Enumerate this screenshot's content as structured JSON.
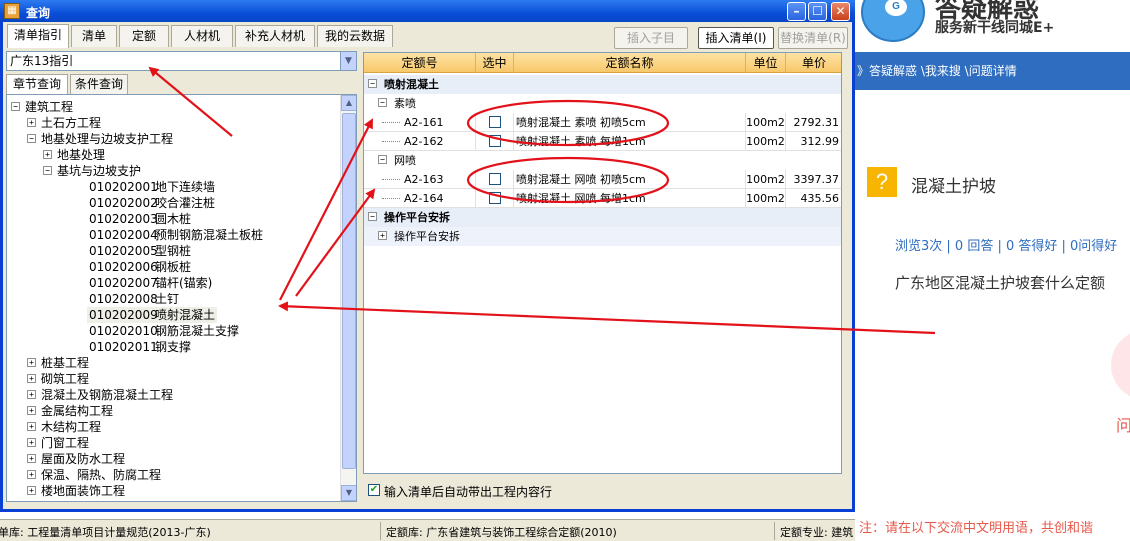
{
  "window": {
    "title": "查询",
    "icon": "calculator-icon",
    "min_glyph": "–",
    "max_glyph": "☐",
    "close_glyph": "✕"
  },
  "tabs": [
    "清单指引",
    "清单",
    "定额",
    "人材机",
    "补充人材机",
    "我的云数据"
  ],
  "toolbar": {
    "insert_child": "插入子目",
    "insert_list": "插入清单(I)",
    "replace_list": "替换清单(R)"
  },
  "combo": {
    "value": "广东13指引",
    "arrow": "▼"
  },
  "subtabs": [
    "章节查询",
    "条件查询"
  ],
  "tree": {
    "nodes": [
      {
        "pm": "−",
        "label": "建筑工程"
      },
      {
        "pm": "+",
        "label": "土石方工程"
      },
      {
        "pm": "−",
        "label": "地基处理与边坡支护工程"
      },
      {
        "pm": "+",
        "label": "地基处理"
      },
      {
        "pm": "−",
        "label": "基坑与边坡支护"
      },
      {
        "code": "010202001",
        "label": "地下连续墙"
      },
      {
        "code": "010202002",
        "label": "咬合灌注桩"
      },
      {
        "code": "010202003",
        "label": "圆木桩"
      },
      {
        "code": "010202004",
        "label": "预制钢筋混凝土板桩"
      },
      {
        "code": "010202005",
        "label": "型钢桩"
      },
      {
        "code": "010202006",
        "label": "钢板桩"
      },
      {
        "code": "010202007",
        "label": "锚杆(锚索)"
      },
      {
        "code": "010202008",
        "label": "土钉"
      },
      {
        "code": "010202009",
        "label": "喷射混凝土",
        "selected": true
      },
      {
        "code": "010202010",
        "label": "钢筋混凝土支撑"
      },
      {
        "code": "010202011",
        "label": "钢支撑"
      },
      {
        "pm": "+",
        "label": "桩基工程"
      },
      {
        "pm": "+",
        "label": "砌筑工程"
      },
      {
        "pm": "+",
        "label": "混凝土及钢筋混凝土工程"
      },
      {
        "pm": "+",
        "label": "金属结构工程"
      },
      {
        "pm": "+",
        "label": "木结构工程"
      },
      {
        "pm": "+",
        "label": "门窗工程"
      },
      {
        "pm": "+",
        "label": "屋面及防水工程"
      },
      {
        "pm": "+",
        "label": "保温、隔热、防腐工程"
      },
      {
        "pm": "+",
        "label": "楼地面装饰工程"
      }
    ],
    "scroll_up": "▲",
    "scroll_down": "▼"
  },
  "grid": {
    "headers": [
      "定额号",
      "选中",
      "定额名称",
      "单位",
      "单价"
    ],
    "rows": [
      {
        "kind": "group",
        "pm": "−",
        "label": "喷射混凝土"
      },
      {
        "kind": "subgroup",
        "pm": "−",
        "label": "素喷"
      },
      {
        "kind": "item",
        "code": "A2-161",
        "name": "喷射混凝土 素喷 初喷5cm",
        "unit": "100m2",
        "price": "2792.31"
      },
      {
        "kind": "item",
        "code": "A2-162",
        "name": "喷射混凝土 素喷 每增1cm",
        "unit": "100m2",
        "price": "312.99"
      },
      {
        "kind": "subgroup",
        "pm": "−",
        "label": "网喷"
      },
      {
        "kind": "item",
        "code": "A2-163",
        "name": "喷射混凝土 网喷 初喷5cm",
        "unit": "100m2",
        "price": "3397.37"
      },
      {
        "kind": "item",
        "code": "A2-164",
        "name": "喷射混凝土 网喷 每增1cm",
        "unit": "100m2",
        "price": "435.56"
      },
      {
        "kind": "group",
        "pm": "−",
        "label": "操作平台安拆"
      },
      {
        "kind": "subgroup2",
        "pm": "+",
        "label": "操作平台安拆"
      }
    ]
  },
  "bottom_checkbox": {
    "label": "输入清单后自动带出工程内容行",
    "checked_glyph": "✔"
  },
  "statusbar": {
    "list_lib": "单库: 工程量清单项目计量规范(2013-广东)",
    "quota_lib": "定额库: 广东省建筑与装饰工程综合定额(2010)",
    "quota_major": "定额专业: 建筑"
  },
  "web": {
    "logo_face": "G",
    "brand": "答疑解惑",
    "slogan": "服务新干线同城E+",
    "nav": "》答疑解惑 \\我来搜 \\问题详情",
    "q_icon": "?",
    "q_title": "混凝土护坡",
    "stats": "浏览3次 | 0 回答 | 0 答得好 | 0问得好",
    "q_text": "广东地区混凝土护坡套什么定额",
    "ask": "问",
    "notice": "注：请在以下交流中文明用语，共创和谐"
  },
  "annotations": {
    "color": "#e3121a"
  }
}
